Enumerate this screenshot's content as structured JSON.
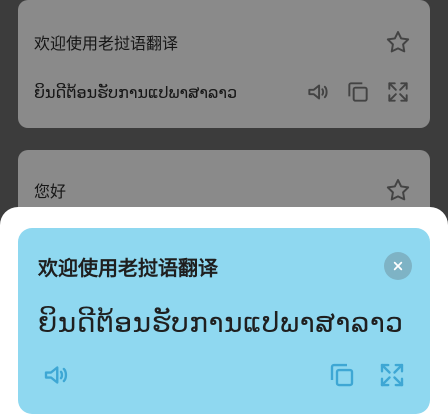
{
  "history": [
    {
      "source": "欢迎使用老挝语翻译",
      "translation": "ຍິນດີຕ້ອນຮັບການແປພາສາລາວ"
    },
    {
      "source": "您好"
    }
  ],
  "popup": {
    "title": "欢迎使用老挝语翻译",
    "translation": "ຍິນດີຕ້ອນຮັບການແປພາສາລາວ"
  },
  "icons": {
    "star": "star-outline-icon",
    "speaker": "speaker-icon",
    "copy": "copy-icon",
    "expand": "expand-icon",
    "close": "close-icon"
  },
  "colors": {
    "accent": "#3ea7d4",
    "popup_bg": "#8fd8f0"
  }
}
